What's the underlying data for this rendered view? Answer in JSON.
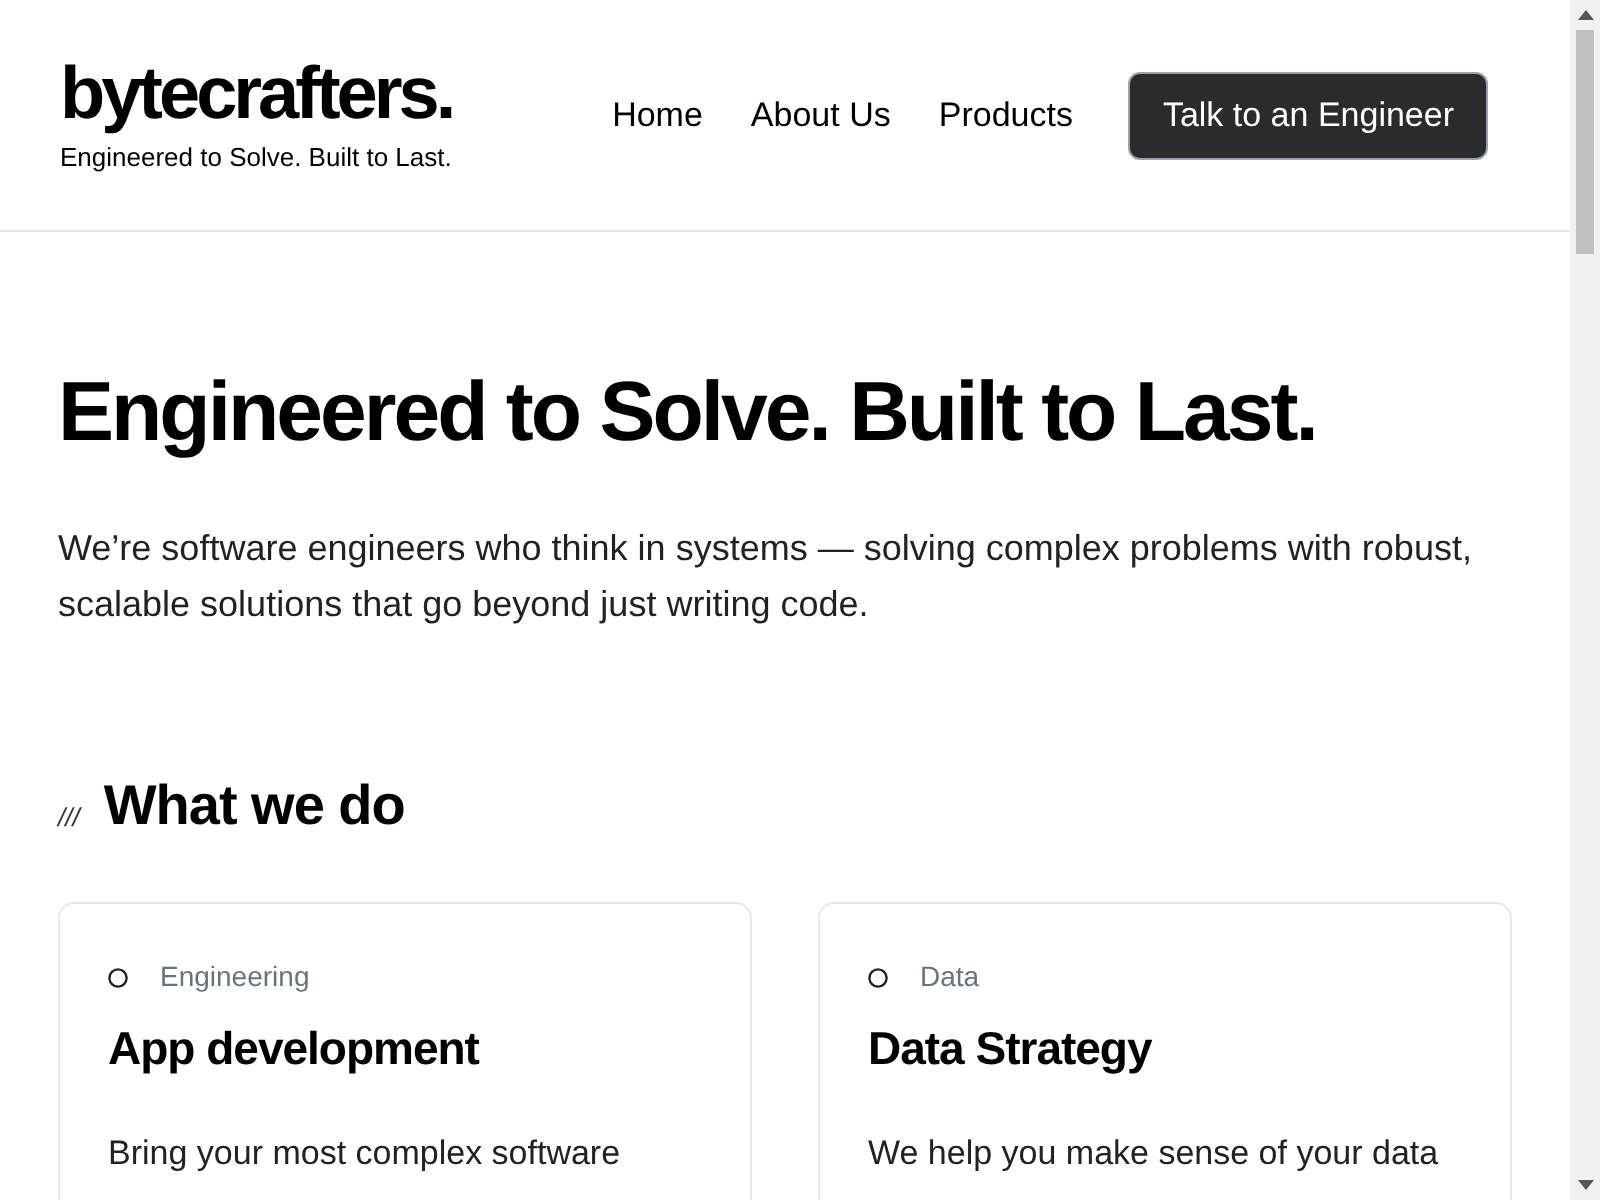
{
  "header": {
    "logo": "bytecrafters.",
    "tagline": "Engineered to Solve. Built to Last.",
    "nav": [
      "Home",
      "About Us",
      "Products"
    ],
    "cta": "Talk to an Engineer"
  },
  "hero": {
    "title": "Engineered to Solve. Built to Last.",
    "text": "We’re software engineers who think in systems — solving complex problems with robust, scalable solutions that go beyond just writing code."
  },
  "section": {
    "mark": "///",
    "title": "What we do"
  },
  "cards": [
    {
      "category": "Engineering",
      "title": "App development",
      "text": "Bring your most complex software"
    },
    {
      "category": "Data",
      "title": "Data Strategy",
      "text": "We help you make sense of your data"
    }
  ]
}
